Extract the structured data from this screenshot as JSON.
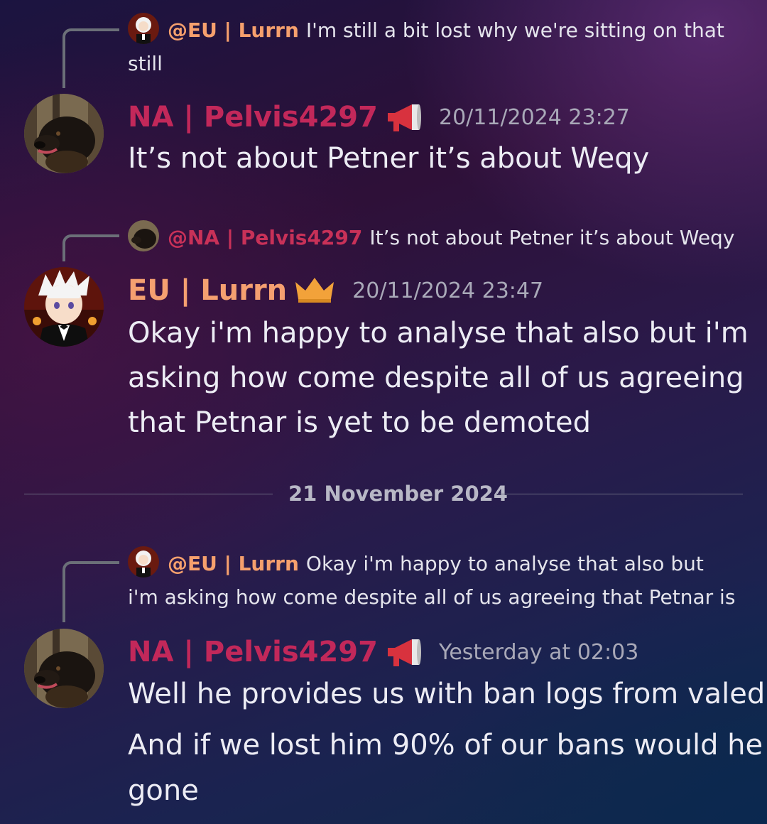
{
  "messages": [
    {
      "reply": {
        "author": "@EU | Lurrn",
        "text": "I'm still a bit lost why we're sitting on that still"
      },
      "author": "NA | Pelvis4297",
      "badge": "megaphone-icon",
      "timestamp": "20/11/2024 23:27",
      "lines": [
        "It’s not about Petner it’s about Weqy"
      ]
    },
    {
      "reply": {
        "author": "@NA | Pelvis4297",
        "text": "It’s not about Petner it’s about Weqy"
      },
      "author": "EU | Lurrn",
      "badge": "crown-icon",
      "timestamp": "20/11/2024 23:47",
      "lines": [
        "Okay i'm happy to analyse that also but i'm",
        "asking how come despite all of us agreeing",
        "that Petnar is yet to be demoted"
      ]
    },
    {
      "reply": {
        "author": "@EU | Lurrn",
        "text": "Okay i'm happy to analyse that also but i'm asking how come despite all of us agreeing that Petnar is"
      },
      "author": "NA | Pelvis4297",
      "badge": "megaphone-icon",
      "timestamp": "Yesterday at 02:03",
      "lines": [
        "Well he provides us with ban logs from valed",
        "And if we lost him 90% of our bans would he",
        "gone"
      ]
    }
  ],
  "date_divider": "21 November 2024",
  "colors": {
    "na_role": "#c2285a",
    "eu_role": "#f5a070",
    "timestamp": "#a9a9b8",
    "text": "#ececf4"
  }
}
